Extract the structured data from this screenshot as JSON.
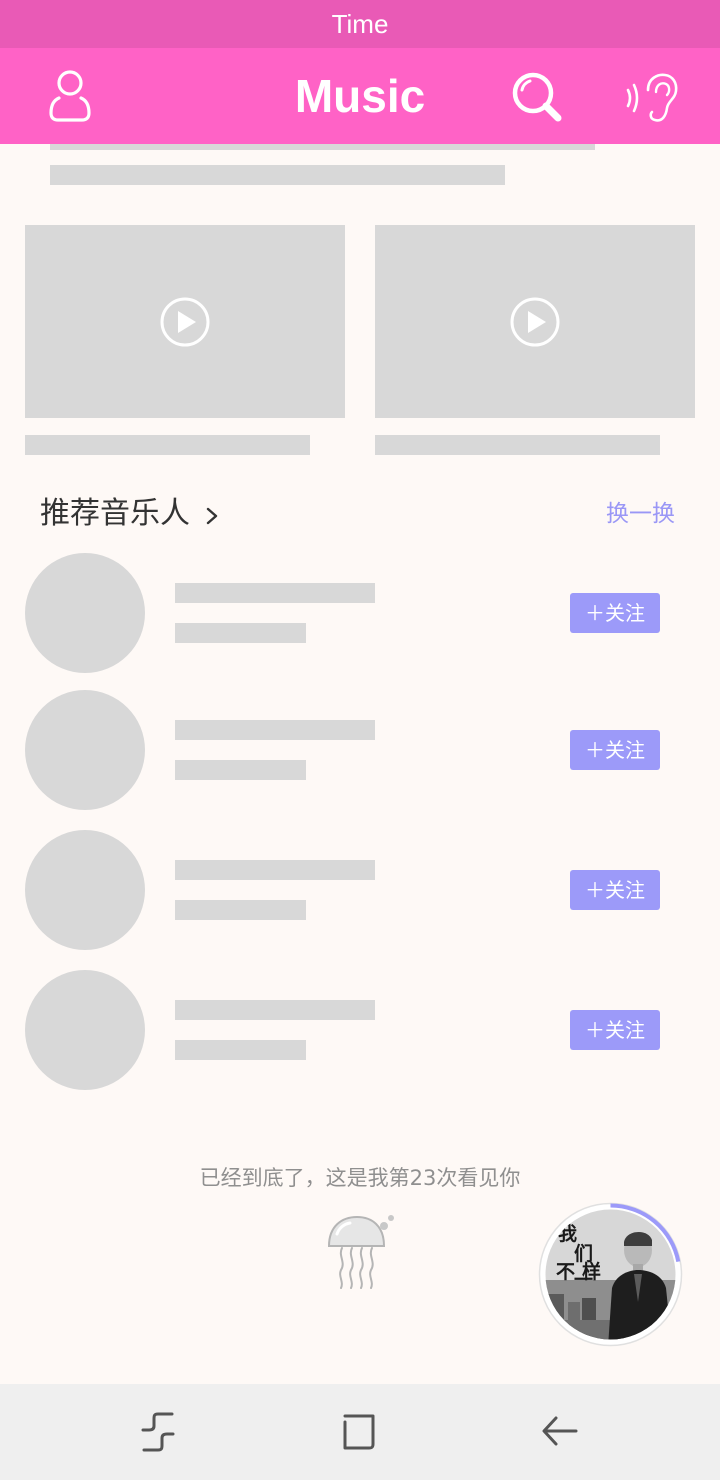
{
  "status_bar": {
    "time": "Time"
  },
  "app_bar": {
    "title": "Music",
    "icons": [
      "user-icon",
      "search-icon",
      "ear-icon"
    ]
  },
  "recommended_artists": {
    "title": "推荐音乐人",
    "refresh_label": "换一换",
    "follow_label": "＋关注",
    "artist_count": 4
  },
  "footer": {
    "message": "已经到底了，这是我第23次看见你"
  },
  "mini_player": {
    "album_art_text": "我们不一样",
    "progress": 0.22
  },
  "colors": {
    "status_bar": "#e95ab6",
    "app_bar": "#ff62c6",
    "accent": "#9c9af9",
    "placeholder": "#d8d8d8",
    "background": "#fef9f6"
  },
  "nav_bar": {
    "icons": [
      "recent-apps-icon",
      "home-icon",
      "back-icon"
    ]
  }
}
